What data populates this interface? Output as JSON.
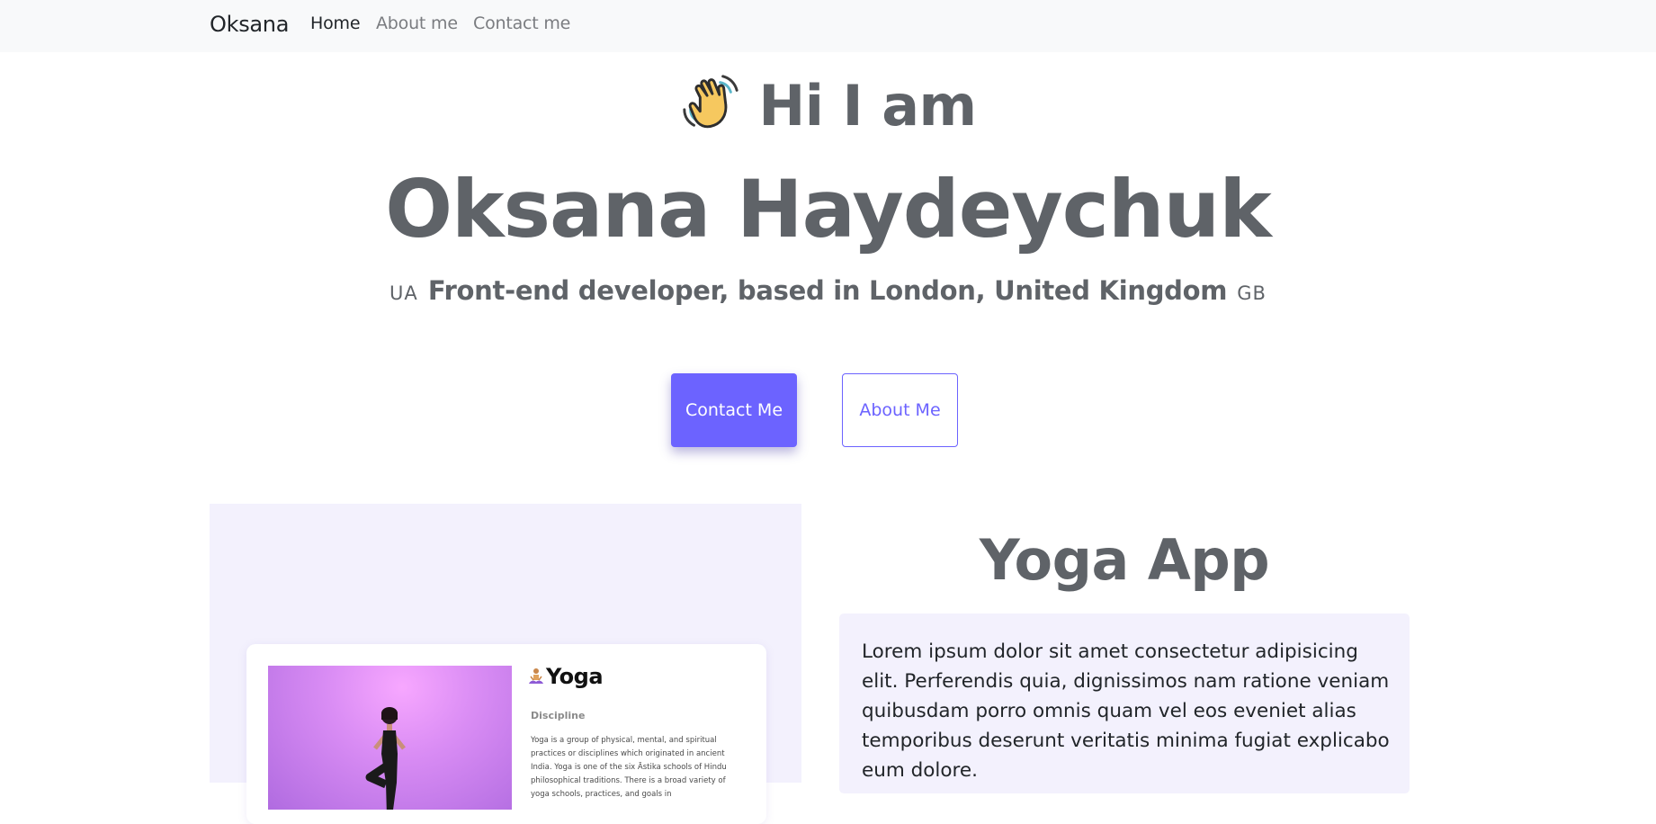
{
  "navbar": {
    "brand": "Oksana",
    "links": [
      {
        "label": "Home",
        "active": true
      },
      {
        "label": "About me",
        "active": false
      },
      {
        "label": "Contact me",
        "active": false
      }
    ]
  },
  "hero": {
    "greeting_icon": "waving-hand-icon",
    "greeting": "Hi I am",
    "name": "Oksana Haydeychuk",
    "flag_left": "UA",
    "subtitle": "Front-end developer, based in London, United Kingdom",
    "flag_right": "GB"
  },
  "buttons": {
    "contact": "Contact Me",
    "about": "About Me"
  },
  "project": {
    "title": "Yoga App",
    "description": "Lorem ipsum dolor sit amet consectetur adipisicing elit. Perferendis quia, dignissimos nam ratione veniam quibusdam porro omnis quam vel eos eveniet alias temporibus deserunt veritatis minima fugiat explicabo eum dolore.",
    "preview": {
      "title": "Yoga",
      "title_icon": "lotus-position-icon",
      "subheading": "Discipline",
      "text": "Yoga is a group of physical, mental, and spiritual practices or disciplines which originated in ancient India. Yoga is one of the six Āstika schools of Hindu philosophical traditions. There is a broad variety of yoga schools, practices, and goals in"
    }
  },
  "colors": {
    "accent": "#6c63ff",
    "heading": "#5f6368",
    "panel": "#f3f1fd",
    "navbar_bg": "#f8f9fa"
  }
}
